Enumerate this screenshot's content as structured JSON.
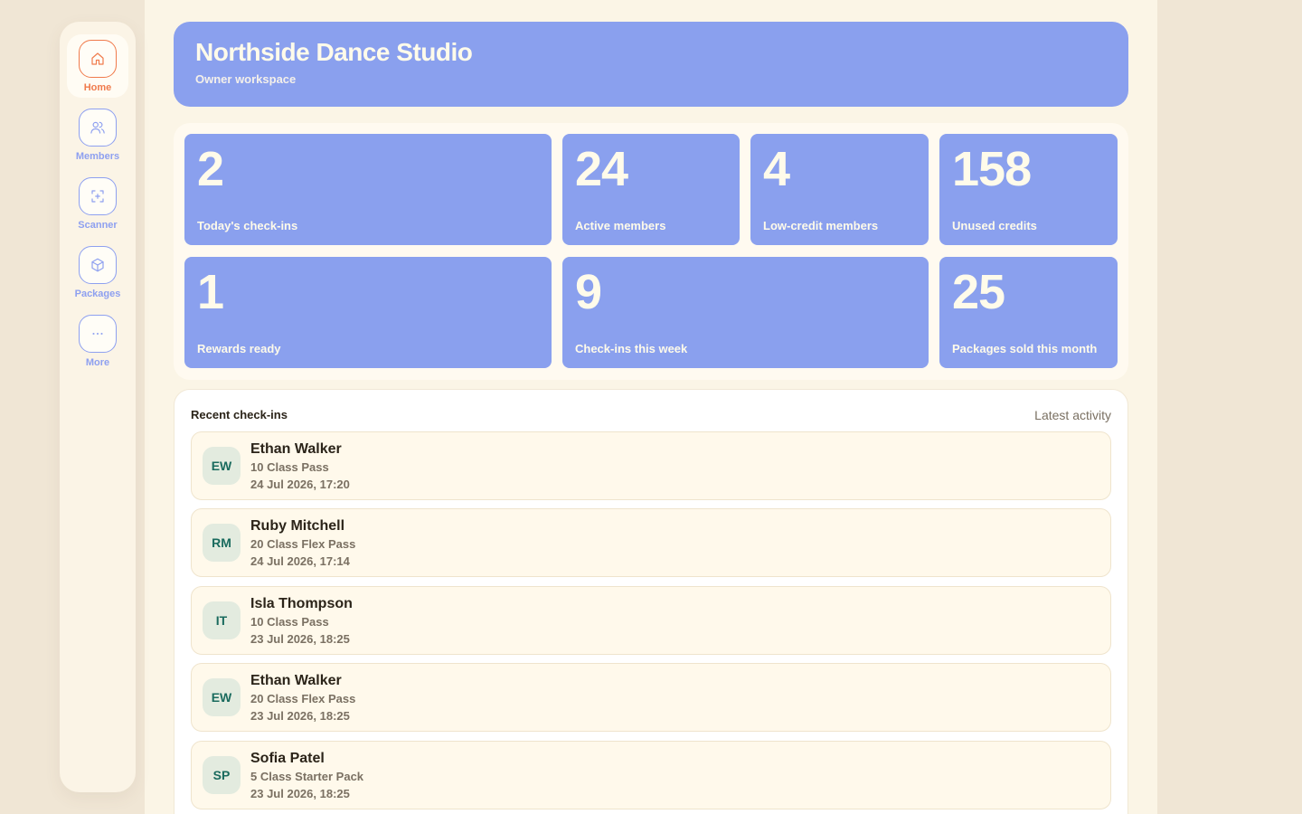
{
  "nav": [
    {
      "key": "home",
      "label": "Home",
      "icon": "home-icon",
      "active": true
    },
    {
      "key": "members",
      "label": "Members",
      "icon": "users-icon",
      "active": false
    },
    {
      "key": "scanner",
      "label": "Scanner",
      "icon": "scan-icon",
      "active": false
    },
    {
      "key": "packages",
      "label": "Packages",
      "icon": "box-icon",
      "active": false
    },
    {
      "key": "more",
      "label": "More",
      "icon": "ellipsis-icon",
      "active": false
    }
  ],
  "header": {
    "title": "Northside Dance Studio",
    "subtitle": "Owner workspace"
  },
  "stats": [
    {
      "value": "2",
      "label": "Today's check-ins"
    },
    {
      "value": "24",
      "label": "Active members"
    },
    {
      "value": "4",
      "label": "Low-credit members"
    },
    {
      "value": "158",
      "label": "Unused credits"
    },
    {
      "value": "1",
      "label": "Rewards ready"
    },
    {
      "value": "9",
      "label": "Check-ins this week"
    },
    {
      "value": "25",
      "label": "Packages sold this month"
    }
  ],
  "recent": {
    "title": "Recent check-ins",
    "meta": "Latest activity",
    "items": [
      {
        "initials": "EW",
        "name": "Ethan Walker",
        "pass": "10 Class Pass",
        "time": "24 Jul 2026, 17:20"
      },
      {
        "initials": "RM",
        "name": "Ruby Mitchell",
        "pass": "20 Class Flex Pass",
        "time": "24 Jul 2026, 17:14"
      },
      {
        "initials": "IT",
        "name": "Isla Thompson",
        "pass": "10 Class Pass",
        "time": "23 Jul 2026, 18:25"
      },
      {
        "initials": "EW",
        "name": "Ethan Walker",
        "pass": "20 Class Flex Pass",
        "time": "23 Jul 2026, 18:25"
      },
      {
        "initials": "SP",
        "name": "Sofia Patel",
        "pass": "5 Class Starter Pack",
        "time": "23 Jul 2026, 18:25"
      }
    ]
  },
  "colors": {
    "accent": "#8aa0ee",
    "active": "#f07b4c",
    "avatar_text": "#1a6b5e"
  }
}
